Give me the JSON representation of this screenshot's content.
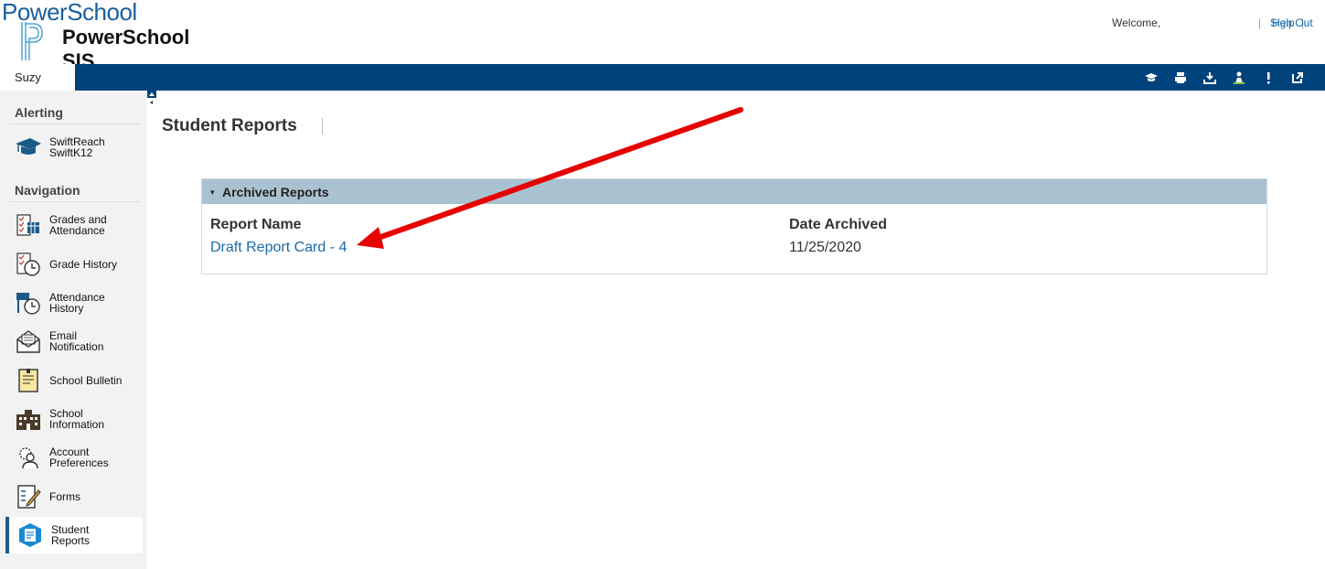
{
  "header": {
    "logo_text": "PowerSchool",
    "product_name": "PowerSchool SIS",
    "welcome": "Welcome,",
    "separator": "|",
    "help": "Help",
    "sign_out": "Sign Out"
  },
  "student_tab": {
    "name": "Suzy"
  },
  "toolbar_icons": [
    "graduation-cap-icon",
    "printer-icon",
    "download-icon",
    "person-icon",
    "alert-icon",
    "external-link-icon"
  ],
  "sidebar": {
    "alerting_heading": "Alerting",
    "swiftreach": {
      "line1": "SwiftReach",
      "line2": "SwiftK12"
    },
    "navigation_heading": "Navigation",
    "items": [
      {
        "line1": "Grades and",
        "line2": "Attendance",
        "icon": "gradebook-icon"
      },
      {
        "line1": "Grade History",
        "line2": "",
        "icon": "grade-history-icon"
      },
      {
        "line1": "Attendance",
        "line2": "History",
        "icon": "attendance-history-icon"
      },
      {
        "line1": "Email",
        "line2": "Notification",
        "icon": "email-icon"
      },
      {
        "line1": "School Bulletin",
        "line2": "",
        "icon": "bulletin-icon"
      },
      {
        "line1": "School",
        "line2": "Information",
        "icon": "school-icon"
      },
      {
        "line1": "Account",
        "line2": "Preferences",
        "icon": "account-preferences-icon"
      },
      {
        "line1": "Forms",
        "line2": "",
        "icon": "forms-icon"
      },
      {
        "line1": "Student",
        "line2": "Reports",
        "icon": "student-reports-icon"
      }
    ]
  },
  "main": {
    "title": "Student Reports",
    "section": {
      "toggle": "▾",
      "title": "Archived Reports",
      "columns": [
        "Report Name",
        "Date Archived"
      ],
      "rows": [
        {
          "report_name": "Draft Report Card - 4",
          "date_archived": "11/25/2020"
        }
      ]
    }
  },
  "colors": {
    "nav_bar": "#00427c",
    "section_header": "#a9c2cf",
    "link": "#1a6aa6",
    "sidebar_bg": "#f2f2f2",
    "annotation_arrow": "#e60000"
  }
}
